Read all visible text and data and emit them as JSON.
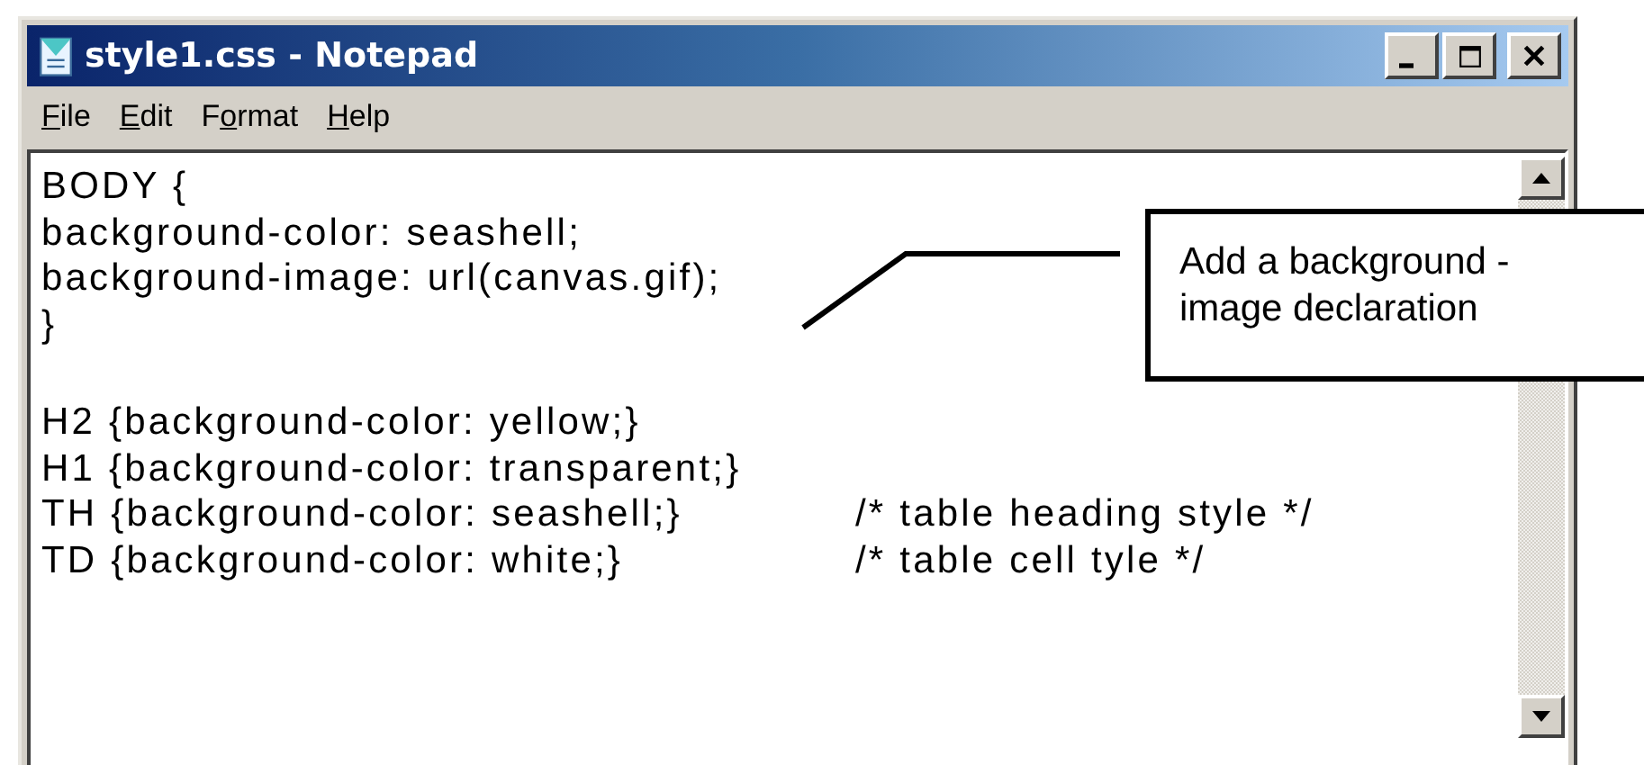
{
  "window": {
    "title": "style1.css - Notepad"
  },
  "menu": [
    {
      "label_parts": [
        {
          "text": "F",
          "underlined": true
        },
        {
          "text": "ile",
          "underlined": false
        }
      ]
    },
    {
      "label_parts": [
        {
          "text": "E",
          "underlined": true
        },
        {
          "text": "dit",
          "underlined": false
        }
      ]
    },
    {
      "label_parts": [
        {
          "text": "F",
          "underlined": false
        },
        {
          "text": "o",
          "underlined": true
        },
        {
          "text": "rmat",
          "underlined": false
        }
      ]
    },
    {
      "label_parts": [
        {
          "text": "H",
          "underlined": true
        },
        {
          "text": "elp",
          "underlined": false
        }
      ]
    }
  ],
  "editor": {
    "lines": [
      {
        "code": "BODY {"
      },
      {
        "code": "background-color: seashell;"
      },
      {
        "code": "background-image: url(canvas.gif);"
      },
      {
        "code": "}"
      },
      {
        "kind": "blank"
      },
      {
        "code": "H2 {background-color: yellow;}"
      },
      {
        "code": "H1 {background-color: transparent;}"
      },
      {
        "code": "TH {background-color: seashell;}",
        "comment": "/* table heading style */"
      },
      {
        "code": "TD {background-color: white;}",
        "comment": "/* table cell tyle */"
      }
    ]
  },
  "callout": {
    "text": "Add a background - image declaration"
  }
}
